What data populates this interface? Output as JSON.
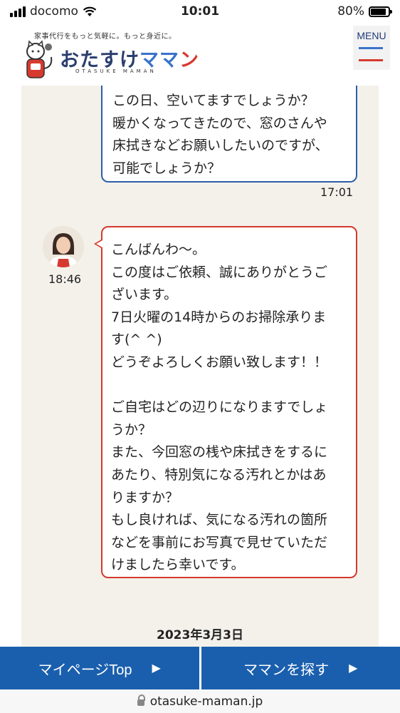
{
  "status_bar": {
    "carrier": "docomo",
    "time": "10:01",
    "battery": "80%"
  },
  "header": {
    "tagline": "家事代行をもっと気軽に。もっと身近に。",
    "logo_part1": "おたすけ",
    "logo_part2": "ママ",
    "logo_part3": "ン",
    "logo_sub": "OTASUKE MAMAN",
    "menu_label": "MENU"
  },
  "chat": {
    "outgoing": {
      "lines": [
        "この日、空いてますでしょうか？",
        "暖かくなってきたので、窓のさんや",
        "床拭きなどお願いしたいのですが、",
        "可能でしょうか？"
      ],
      "time": "17:01"
    },
    "incoming": {
      "time": "18:46",
      "lines": [
        "こんばんわ〜。",
        "この度はご依頼、誠にありがとうご",
        "ざいます。",
        "7日火曜の14時からのお掃除承りま",
        "す(^ ^)",
        "どうぞよろしくお願い致します！！",
        "",
        "ご自宅はどの辺りになりますでしょ",
        "うか？",
        "また、今回窓の桟や床拭きをするに",
        "あたり、特別気になる汚れとかはあ",
        "りますか？",
        "もし良ければ、気になる汚れの箇所",
        "などを事前にお写真で見せていただ",
        "けましたら幸いです。"
      ]
    },
    "date_separator": "2023年3月3日"
  },
  "bottom_nav": {
    "mypage_label": "マイページTop",
    "search_label": "ママンを探す",
    "arrow": "▶"
  },
  "url": "otasuke-maman.jp",
  "colors": {
    "blue": "#1a5fae",
    "red": "#d33a2e",
    "chat_bg": "#f4f1eb"
  }
}
